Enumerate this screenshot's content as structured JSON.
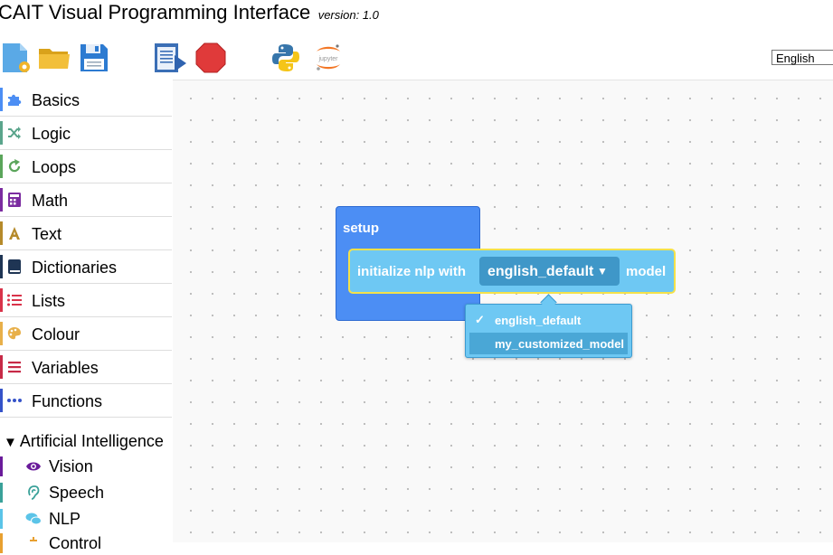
{
  "app": {
    "title": "CAIT Visual Programming Interface",
    "version": "version: 1.0"
  },
  "toolbar": {
    "buttons": [
      {
        "name": "new-file-button",
        "icon": "new-file-icon"
      },
      {
        "name": "open-folder-button",
        "icon": "folder-icon"
      },
      {
        "name": "save-button",
        "icon": "floppy-disk-icon"
      },
      {
        "name": "run-button",
        "icon": "run-script-icon"
      },
      {
        "name": "stop-button",
        "icon": "stop-sign-icon"
      },
      {
        "name": "python-button",
        "icon": "python-icon"
      },
      {
        "name": "jupyter-button",
        "icon": "jupyter-icon",
        "label": "jupyter"
      }
    ],
    "language": "English"
  },
  "toolbox": {
    "categories": [
      {
        "label": "Basics",
        "color": "#4c8ef4",
        "icon": "puzzle-icon"
      },
      {
        "label": "Logic",
        "color": "#5ba58c",
        "icon": "shuffle-icon"
      },
      {
        "label": "Loops",
        "color": "#5ba55b",
        "icon": "loop-arrow-icon"
      },
      {
        "label": "Math",
        "color": "#7b2ca0",
        "icon": "calculator-icon"
      },
      {
        "label": "Text",
        "color": "#b58a2a",
        "icon": "text-a-icon"
      },
      {
        "label": "Dictionaries",
        "color": "#1f3554",
        "icon": "book-icon"
      },
      {
        "label": "Lists",
        "color": "#d9334a",
        "icon": "list-icon"
      },
      {
        "label": "Colour",
        "color": "#e8b04a",
        "icon": "palette-icon"
      },
      {
        "label": "Variables",
        "color": "#c72a47",
        "icon": "variables-icon"
      },
      {
        "label": "Functions",
        "color": "#3553c9",
        "icon": "dots-icon"
      }
    ],
    "ai_section": {
      "label": "Artificial Intelligence",
      "items": [
        {
          "label": "Vision",
          "color": "#6a1b9a",
          "icon": "eye-icon"
        },
        {
          "label": "Speech",
          "color": "#3aa199",
          "icon": "ear-icon"
        },
        {
          "label": "NLP",
          "color": "#5bc4e8",
          "icon": "chat-bubbles-icon"
        },
        {
          "label": "Control",
          "color": "#e8a030",
          "icon": "control-icon"
        }
      ]
    }
  },
  "workspace": {
    "setup_block": {
      "label": "setup",
      "color": "#4c8ef4"
    },
    "nlp_block": {
      "prefix": "initialize nlp with",
      "selected": "english_default",
      "suffix": "model",
      "color": "#6ec8f3"
    },
    "dropdown_menu": {
      "options": [
        {
          "label": "english_default",
          "checked": true
        },
        {
          "label": "my_customized_model",
          "checked": false,
          "highlighted": true
        }
      ]
    }
  }
}
